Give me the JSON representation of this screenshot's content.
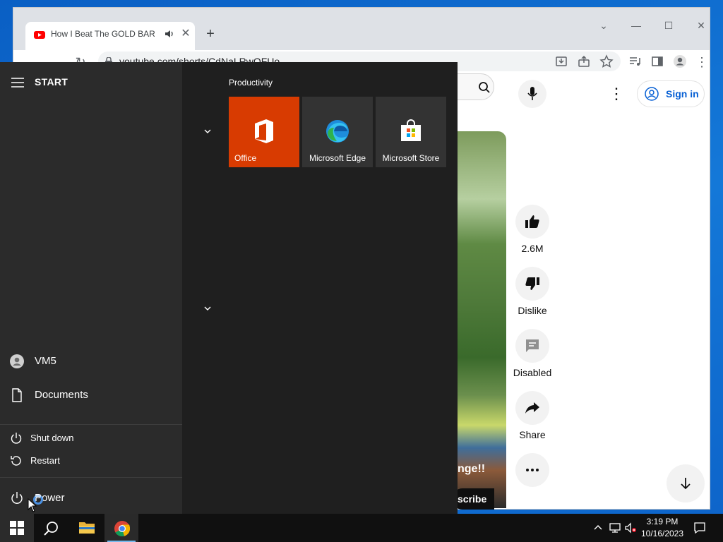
{
  "browser": {
    "tab": {
      "title": "How I Beat The GOLD BAR Ch",
      "favicon": "youtube-icon",
      "audio": "speaker-icon"
    },
    "url": "youtube.com/shorts/CdNaLRwOFUo",
    "accent": "#dee1e6"
  },
  "youtube": {
    "signin_label": "Sign in",
    "video_overlay_text": "nge!!",
    "subscribe_label": "scribe",
    "actions": [
      {
        "icon": "thumbs-up-icon",
        "label": "2.6M"
      },
      {
        "icon": "thumbs-down-icon",
        "label": "Dislike"
      },
      {
        "icon": "comment-icon",
        "label": "Disabled"
      },
      {
        "icon": "share-icon",
        "label": "Share"
      },
      {
        "icon": "more-icon",
        "label": ""
      }
    ],
    "brand_color": "#065fd4"
  },
  "start_menu": {
    "title": "START",
    "user": "VM5",
    "documents": "Documents",
    "power_options": [
      "Shut down",
      "Restart"
    ],
    "power": "Power",
    "group_title": "Productivity",
    "tiles": [
      {
        "label": "Office",
        "icon": "office-icon",
        "color": "#d83b01"
      },
      {
        "label": "Microsoft Edge",
        "icon": "edge-icon",
        "color": "#333333"
      },
      {
        "label": "Microsoft Store",
        "icon": "store-icon",
        "color": "#333333"
      }
    ]
  },
  "taskbar": {
    "time": "3:19 PM",
    "date": "10/16/2023",
    "pinned": [
      "windows-start-icon",
      "search-icon",
      "file-explorer-icon",
      "chrome-icon"
    ]
  }
}
